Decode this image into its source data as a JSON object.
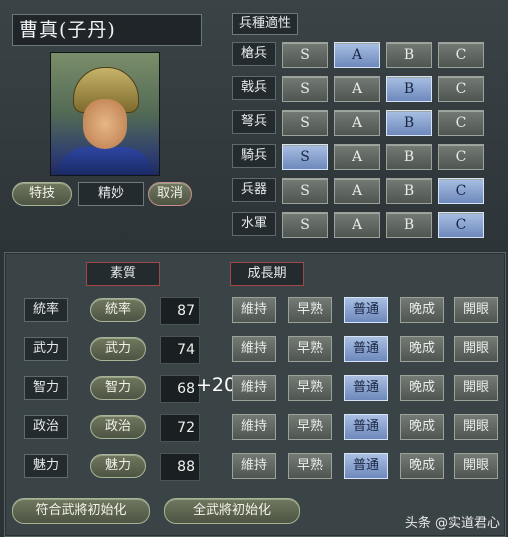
{
  "general": {
    "name": "曹真(子丹)"
  },
  "skill": {
    "button": "特技",
    "value": "精妙",
    "cancel": "取消"
  },
  "troops": {
    "header": "兵種適性",
    "grades": [
      "S",
      "A",
      "B",
      "C"
    ],
    "rows": [
      {
        "label": "槍兵",
        "selected": "A"
      },
      {
        "label": "戟兵",
        "selected": "B"
      },
      {
        "label": "弩兵",
        "selected": "B"
      },
      {
        "label": "騎兵",
        "selected": "S"
      },
      {
        "label": "兵器",
        "selected": "C"
      },
      {
        "label": "水軍",
        "selected": "C"
      }
    ]
  },
  "stats": {
    "header_quality": "素質",
    "header_growth": "成長期",
    "growth_options": [
      "維持",
      "早熟",
      "普通",
      "晚成",
      "開眼"
    ],
    "rows": [
      {
        "label": "統率",
        "button": "統率",
        "value": "87",
        "growth": "普通",
        "bonus": ""
      },
      {
        "label": "武力",
        "button": "武力",
        "value": "74",
        "growth": "普通",
        "bonus": ""
      },
      {
        "label": "智力",
        "button": "智力",
        "value": "68",
        "growth": "普通",
        "bonus": "+20"
      },
      {
        "label": "政治",
        "button": "政治",
        "value": "72",
        "growth": "普通",
        "bonus": ""
      },
      {
        "label": "魅力",
        "button": "魅力",
        "value": "88",
        "growth": "普通",
        "bonus": ""
      }
    ]
  },
  "footer": {
    "init_matching": "符合武將初始化",
    "init_all": "全武將初始化"
  },
  "watermark": "头条 @实道君心"
}
